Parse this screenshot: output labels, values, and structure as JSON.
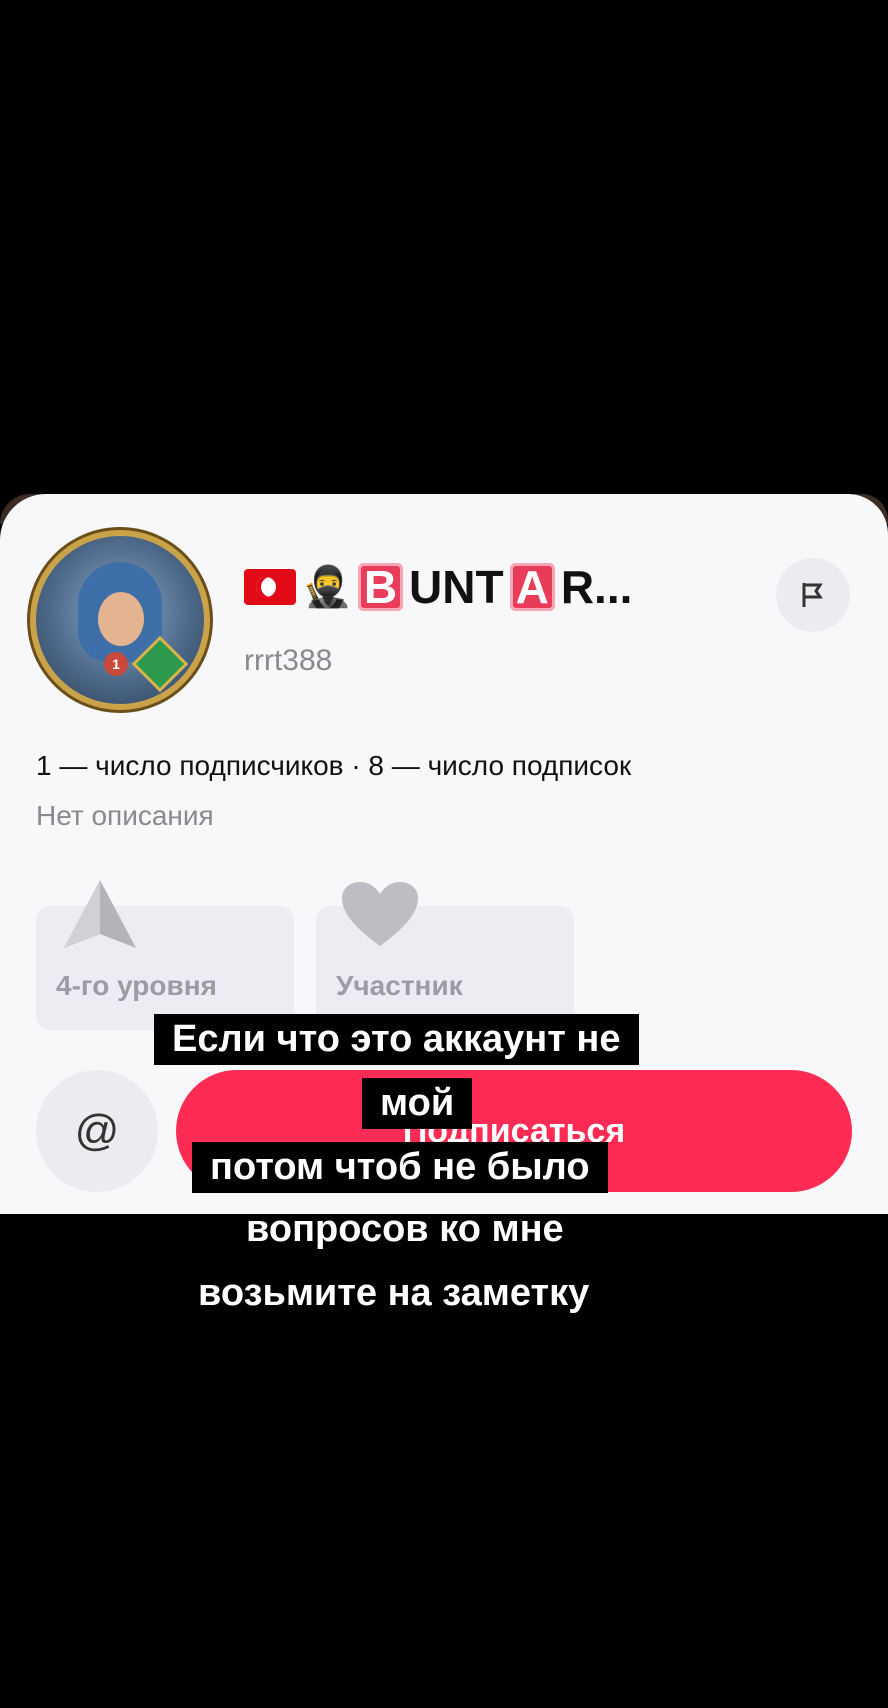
{
  "profile": {
    "display_name_text": "UNT",
    "display_name_box1": "B",
    "display_name_box2": "A",
    "display_name_tail": "R...",
    "handle": "rrrt388",
    "avatar_badge": "1",
    "stats": "1 — число подписчиков · 8 — число подписок",
    "description": "Нет описания"
  },
  "badges": [
    {
      "label": "4-го уровня",
      "icon": "level-arrow-icon"
    },
    {
      "label": "Участник",
      "icon": "heart-icon"
    }
  ],
  "actions": {
    "mention_symbol": "@",
    "follow_label": "Подписаться"
  },
  "captions": [
    "Если что это аккаунт не",
    "мой",
    "потом чтоб не было",
    "вопросов ко мне",
    "возьмите на заметку"
  ],
  "colors": {
    "accent": "#fe2c55",
    "card_bg": "#f8f8fa"
  }
}
